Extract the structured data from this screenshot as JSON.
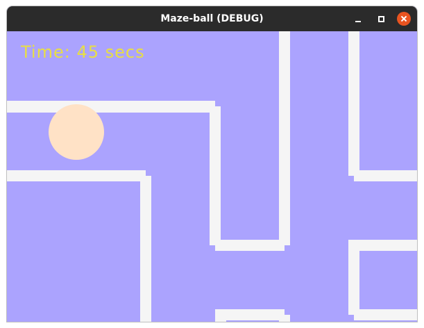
{
  "window": {
    "title": "Maze-ball (DEBUG)",
    "controls": {
      "minimize_icon": "minimize-icon",
      "maximize_icon": "maximize-icon",
      "close_icon": "close-icon"
    }
  },
  "game": {
    "timer_label": "Time:",
    "timer_value": "45",
    "timer_unit": "secs",
    "colors": {
      "background": "#aba3fe",
      "wall": "#f5f5f5",
      "ball": "#ffe2c6",
      "timer_text": "#e8df43",
      "titlebar": "#2b2b2b",
      "close_button": "#e95420"
    }
  }
}
